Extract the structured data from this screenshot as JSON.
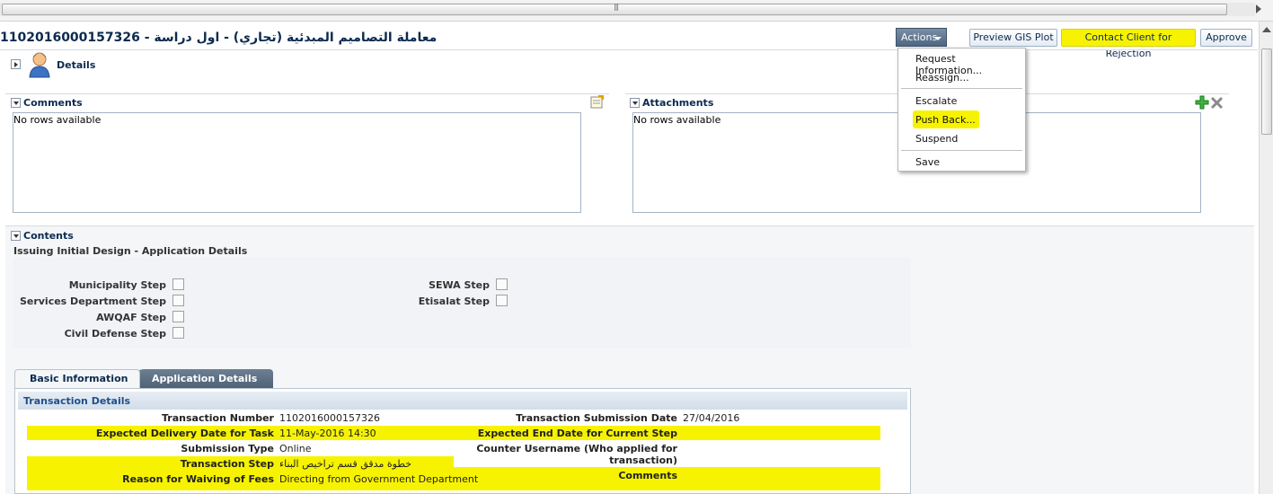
{
  "page": {
    "title": "معاملة التصاميم المبدئية (تجاري) - اول دراسة - 1102016000157326"
  },
  "toolbar": {
    "actions_label": "Actions",
    "preview_label": "Preview GIS Plot",
    "contact_label": "Contact Client for Rejection",
    "approve_label": "Approve"
  },
  "actions_menu": {
    "items": [
      "Request Information...",
      "Reassign...",
      "Escalate",
      "Push Back...",
      "Suspend",
      "Save"
    ],
    "highlighted": "Push Back..."
  },
  "details": {
    "title": "Details"
  },
  "comments": {
    "title": "Comments",
    "empty": "No rows available"
  },
  "attachments": {
    "title": "Attachments",
    "empty": "No rows available"
  },
  "contents": {
    "title": "Contents",
    "subtitle": "Issuing Initial Design - Application Details",
    "steps_left": [
      "Municipality Step",
      "Services Department Step",
      "AWQAF Step",
      "Civil Defense Step"
    ],
    "steps_right": [
      "SEWA Step",
      "Etisalat Step"
    ]
  },
  "tabs": {
    "basic": "Basic Information",
    "application": "Application Details"
  },
  "transaction": {
    "section_title": "Transaction Details",
    "left": [
      {
        "label": "Transaction Number",
        "value": "1102016000157326"
      },
      {
        "label": "Expected Delivery Date for Task",
        "value": "11-May-2016 14:30"
      },
      {
        "label": "Submission Type",
        "value": "Online"
      },
      {
        "label": "Transaction Step",
        "value": "خطوة مدقق قسم تراخيص البناء"
      },
      {
        "label": "Reason for Waiving of Fees",
        "value": "Directing from Government Department"
      }
    ],
    "right": [
      {
        "label": "Transaction Submission Date",
        "value": "27/04/2016"
      },
      {
        "label": "Expected End Date for Current Step",
        "value": ""
      },
      {
        "label": "Counter Username (Who applied for",
        "label2": "transaction)",
        "value": ""
      },
      {
        "label": "Comments",
        "value": ""
      }
    ]
  },
  "colors": {
    "highlight": "#f7f300",
    "title_blue": "#0b2a4f"
  }
}
